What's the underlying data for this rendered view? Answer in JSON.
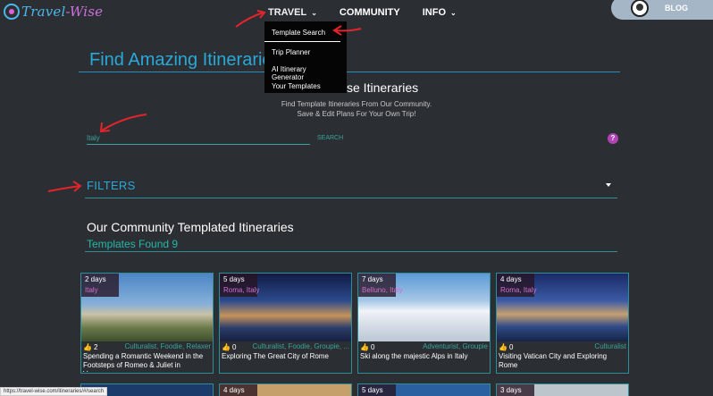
{
  "logo": {
    "text_a": "Travel",
    "text_b": "-Wise"
  },
  "nav": {
    "travel": "TRAVEL",
    "community": "COMMUNITY",
    "info": "INFO",
    "blog": "BLOG"
  },
  "dropdown": {
    "items": [
      "Template Search",
      "Trip Planner",
      "AI Itinerary Generator",
      "Your Templates"
    ]
  },
  "hero": {
    "title": "Find Amazing Itineraries",
    "section_title_visible": "se Itineraries",
    "subtitle_1": "Find Template Itineraries From Our Community.",
    "subtitle_2": "Save & Edit Plans For Your Own Trip!"
  },
  "search": {
    "value": "Italy",
    "button": "SEARCH",
    "help": "?"
  },
  "filters": {
    "label": "FILTERS"
  },
  "community": {
    "title": "Our Community Templated Itineraries",
    "found": "Templates Found 9"
  },
  "cards": [
    {
      "days": "2 days",
      "location": "Italy",
      "likes": "2",
      "tags": "Culturalist, Foodie, Relaxer",
      "title": "Spending a Romantic Weekend in the Footsteps of Romeo & Juliet in Verona,..."
    },
    {
      "days": "5 days",
      "location": "Roma, Italy",
      "likes": "0",
      "tags": "Culturalist, Foodie, Groupie, ...",
      "title": "Exploring The Great City of Rome"
    },
    {
      "days": "7 days",
      "location": "Belluno, Italy",
      "likes": "0",
      "tags": "Adventurist, Groupie",
      "title": "Ski along the majestic Alps in Italy"
    },
    {
      "days": "4 days",
      "location": "Roma, Italy",
      "likes": "0",
      "tags": "Culturalist",
      "title": "Visiting Vatican City and Exploring Rome"
    }
  ],
  "cards_row2": [
    {
      "days": ""
    },
    {
      "days": "4 days"
    },
    {
      "days": "5 days"
    },
    {
      "days": "3 days"
    }
  ],
  "status_bar": "https://travel-wise.com/itineraries/#/search",
  "colors": {
    "accent_blue": "#2aa8d8",
    "accent_teal": "#3aa39b",
    "accent_pink": "#d36fcf",
    "annotation_red": "#e3242b"
  }
}
